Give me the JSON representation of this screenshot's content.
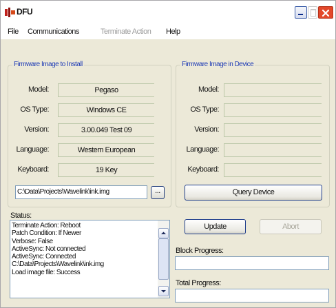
{
  "window": {
    "title": "DFU"
  },
  "menu": {
    "items": [
      {
        "label": "File"
      },
      {
        "label": "Communications"
      },
      {
        "label": "Terminate Action"
      },
      {
        "label": "Help"
      }
    ]
  },
  "install": {
    "title": "Firmware Image to Install",
    "labels": {
      "model": "Model:",
      "os_type": "OS Type:",
      "version": "Version:",
      "language": "Language:",
      "keyboard": "Keyboard:"
    },
    "values": {
      "model": "Pegaso",
      "os_type": "Windows CE",
      "version": "3.00.049 Test 09",
      "language": "Western European",
      "keyboard": "19 Key"
    },
    "path": "C:\\Data\\Projects\\Wavelink\\ink.img",
    "browse_label": "..."
  },
  "device": {
    "title": "Firmware Image in Device",
    "labels": {
      "model": "Model:",
      "os_type": "OS Type:",
      "version": "Version:",
      "language": "Language:",
      "keyboard": "Keyboard:"
    },
    "values": {
      "model": "",
      "os_type": "",
      "version": "",
      "language": "",
      "keyboard": ""
    },
    "query_label": "Query Device"
  },
  "status": {
    "label": "Status:",
    "lines": [
      "Terminate Action: Reboot",
      "Patch Condition: If Newer",
      "Verbose: False",
      "ActiveSync: Not connected",
      "ActiveSync: Connected",
      "C:\\Data\\Projects\\Wavelink\\ink.img",
      "Load image file: Success"
    ]
  },
  "actions": {
    "update_label": "Update",
    "abort_label": "Abort"
  },
  "progress": {
    "block_label": "Block Progress:",
    "block_value": 0,
    "total_label": "Total Progress:",
    "total_value": 0
  },
  "colors": {
    "group_title": "#1e3bb5",
    "window_bg": "#ece9d8",
    "close_button": "#e3482a"
  },
  "icons": {
    "app": "dfu-app-icon",
    "minimize": "minimize-icon",
    "maximize": "maximize-icon",
    "close": "close-icon",
    "scroll_up": "chevron-up-icon",
    "scroll_down": "chevron-down-icon"
  }
}
